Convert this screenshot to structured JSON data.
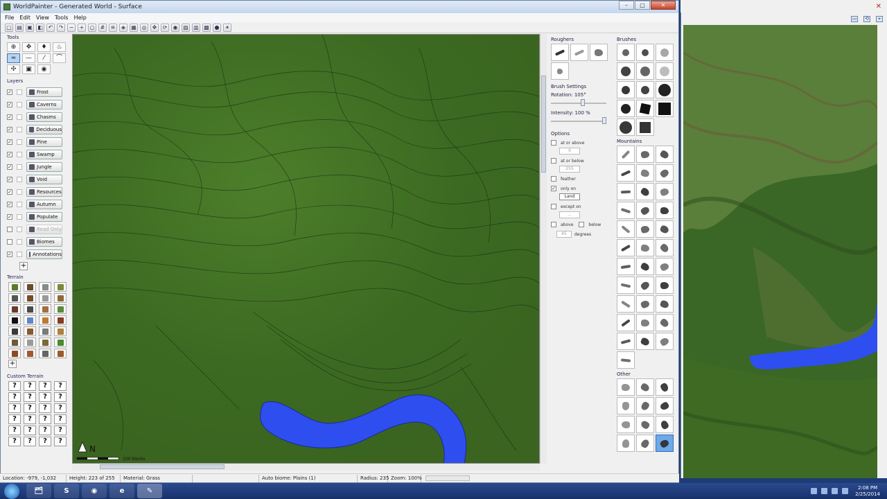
{
  "window": {
    "title": "WorldPainter - Generated World - Surface",
    "controls": {
      "minimize": "–",
      "maximize": "□",
      "close": "✕"
    }
  },
  "menu": [
    "File",
    "Edit",
    "View",
    "Tools",
    "Help"
  ],
  "toolbar_icons": [
    "new-icon",
    "open-icon",
    "save-icon",
    "export-icon",
    "undo-icon",
    "redo-icon",
    "zoom-out-icon",
    "zoom-in-icon",
    "zoom-reset-icon",
    "grid-icon",
    "contours-icon",
    "view-icon",
    "layers-icon",
    "globe-icon",
    "move-icon",
    "rotate-icon",
    "target-icon",
    "image-icon",
    "overlay-icon",
    "chest-icon",
    "biome-icon",
    "light-icon"
  ],
  "tools": {
    "title": "Tools",
    "items": [
      "⊕",
      "✥",
      "♦",
      "♨",
      "≈",
      "—",
      "⁄",
      "⌒",
      "✣",
      "▣",
      "◉"
    ]
  },
  "layers": {
    "title": "Layers",
    "items": [
      {
        "label": "Frost",
        "checked": true,
        "enabled": true
      },
      {
        "label": "Caverns",
        "checked": true,
        "enabled": true
      },
      {
        "label": "Chasms",
        "checked": true,
        "enabled": true
      },
      {
        "label": "Deciduous",
        "checked": true,
        "enabled": true
      },
      {
        "label": "Pine",
        "checked": true,
        "enabled": true
      },
      {
        "label": "Swamp",
        "checked": true,
        "enabled": true
      },
      {
        "label": "Jungle",
        "checked": true,
        "enabled": true
      },
      {
        "label": "Void",
        "checked": true,
        "enabled": true
      },
      {
        "label": "Resources",
        "checked": true,
        "enabled": true
      },
      {
        "label": "Autumn",
        "checked": true,
        "enabled": true
      },
      {
        "label": "Populate",
        "checked": true,
        "enabled": true
      },
      {
        "label": "Read Only",
        "checked": false,
        "enabled": false
      },
      {
        "label": "Biomes",
        "checked": false,
        "enabled": true
      },
      {
        "label": "Annotations",
        "checked": true,
        "enabled": true
      }
    ],
    "add_label": "+"
  },
  "terrain": {
    "title": "Terrain",
    "colors": [
      "#5a7a2a",
      "#6a4a2a",
      "#8a8a88",
      "#7a8a3a",
      "#555555",
      "#7a4a28",
      "#9a9a98",
      "#8c6a3a",
      "#6a3a2a",
      "#4a4a4a",
      "#a07040",
      "#5a8a3a",
      "#111111",
      "#5f86c8",
      "#c07a30",
      "#8a3a20",
      "#3a3a3a",
      "#8a5a2a",
      "#7a7a7a",
      "#b0803a",
      "#6a5a3a",
      "#9a9a9a",
      "#7a6a3a",
      "#4c8a2c",
      "#8a4a28",
      "#a05a30",
      "#666666",
      "#9c5a2a"
    ],
    "add_label": "+"
  },
  "custom_terrain": {
    "title": "Custom Terrain",
    "placeholder": "?",
    "count": 24
  },
  "roughers": {
    "title": "Roughers",
    "brush_settings_title": "Brush Settings",
    "rotation": "Rotation: 105°",
    "rotation_value": 0.58,
    "intensity": "Intensity: 100 %",
    "intensity_value": 1.0,
    "options_title": "Options",
    "options": [
      {
        "label": "at or above",
        "checked": false,
        "value": "0"
      },
      {
        "label": "at or below",
        "checked": false,
        "value": "255"
      },
      {
        "label": "feather",
        "checked": false,
        "value": ""
      },
      {
        "label": "only on",
        "checked": true,
        "value": "Land"
      },
      {
        "label": "except on",
        "checked": false,
        "value": "..."
      }
    ],
    "above_label": "above",
    "below_label": "below",
    "degrees_label": "degrees",
    "degrees_value": "45"
  },
  "brushes_title": "Brushes",
  "mountains_title": "Mountains",
  "other_title": "Other",
  "map": {
    "scale_label": "100 blocks",
    "north_label": "N"
  },
  "status": {
    "location": "Location: -979, -1,032",
    "height": "Height: 223 of 255",
    "material": "Material: Grass",
    "biome": "Auto biome: Plains (1)",
    "radius": "Radius: 235",
    "zoom": "Zoom: 100%"
  },
  "taskbar": {
    "time": "2:08 PM",
    "date": "2/25/2014",
    "apps": [
      "🗂",
      "S",
      "◉",
      "e",
      "✎"
    ]
  },
  "colors": {
    "terrain_green": "#3f6e23",
    "water_blue": "#2f4ef0",
    "selected_brush": "#6fa8e8"
  }
}
